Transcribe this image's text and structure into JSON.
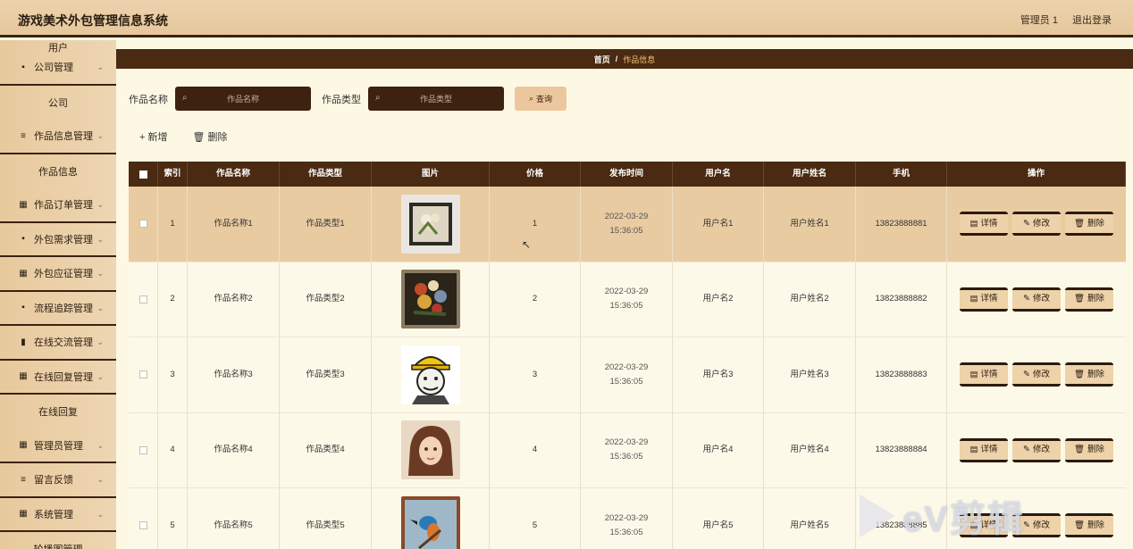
{
  "header": {
    "title": "游戏美术外包管理信息系统",
    "user": "管理员 1",
    "logout": "退出登录"
  },
  "sidebar": {
    "items": [
      {
        "type": "sub",
        "label": "用户"
      },
      {
        "type": "group",
        "icon": "▪",
        "label": "公司管理"
      },
      {
        "type": "sub",
        "label": "公司"
      },
      {
        "type": "group",
        "icon": "≡",
        "label": "作品信息管理"
      },
      {
        "type": "sub",
        "label": "作品信息"
      },
      {
        "type": "group",
        "icon": "▦",
        "label": "作品订单管理"
      },
      {
        "type": "group",
        "icon": "▪",
        "label": "外包需求管理"
      },
      {
        "type": "group",
        "icon": "▦",
        "label": "外包应征管理"
      },
      {
        "type": "group",
        "icon": "▪",
        "label": "流程追踪管理"
      },
      {
        "type": "group",
        "icon": "▮",
        "label": "在线交流管理"
      },
      {
        "type": "group",
        "icon": "▦",
        "label": "在线回复管理"
      },
      {
        "type": "sub",
        "label": "在线回复"
      },
      {
        "type": "group",
        "icon": "▦",
        "label": "管理员管理"
      },
      {
        "type": "group",
        "icon": "≡",
        "label": "留言反馈"
      },
      {
        "type": "group",
        "icon": "▦",
        "label": "系统管理"
      },
      {
        "type": "sub",
        "label": "轮播图管理"
      }
    ]
  },
  "breadcrumb": {
    "home": "首页",
    "sep": "/",
    "current": "作品信息"
  },
  "search": {
    "name_label": "作品名称",
    "name_placeholder": "作品名称",
    "type_label": "作品类型",
    "type_placeholder": "作品类型",
    "query_label": "查询"
  },
  "actions": {
    "add": "+ 新增",
    "delete": "删除"
  },
  "table": {
    "columns": [
      "索引",
      "作品名称",
      "作品类型",
      "图片",
      "价格",
      "发布时间",
      "用户名",
      "用户姓名",
      "手机",
      "操作"
    ],
    "rows": [
      {
        "idx": "1",
        "name": "作品名称1",
        "type": "作品类型1",
        "price": "1",
        "time": "2022-03-29 15:36:05",
        "user": "用户名1",
        "uname": "用户姓名1",
        "phone": "13823888881"
      },
      {
        "idx": "2",
        "name": "作品名称2",
        "type": "作品类型2",
        "price": "2",
        "time": "2022-03-29 15:36:05",
        "user": "用户名2",
        "uname": "用户姓名2",
        "phone": "13823888882"
      },
      {
        "idx": "3",
        "name": "作品名称3",
        "type": "作品类型3",
        "price": "3",
        "time": "2022-03-29 15:36:05",
        "user": "用户名3",
        "uname": "用户姓名3",
        "phone": "13823888883"
      },
      {
        "idx": "4",
        "name": "作品名称4",
        "type": "作品类型4",
        "price": "4",
        "time": "2022-03-29 15:36:05",
        "user": "用户名4",
        "uname": "用户姓名4",
        "phone": "13823888884"
      },
      {
        "idx": "5",
        "name": "作品名称5",
        "type": "作品类型5",
        "price": "5",
        "time": "2022-03-29 15:36:05",
        "user": "用户名5",
        "uname": "用户姓名5",
        "phone": "13823888885"
      }
    ],
    "ops": {
      "detail": "详情",
      "edit": "修改",
      "delete": "删除"
    }
  },
  "watermark": {
    "text": "eV剪辑"
  },
  "colors": {
    "header_bg": "#e8cca3",
    "dark_brown": "#4a2a12",
    "selected_row": "#e8cba1",
    "page_bg": "#fdf8e3"
  }
}
